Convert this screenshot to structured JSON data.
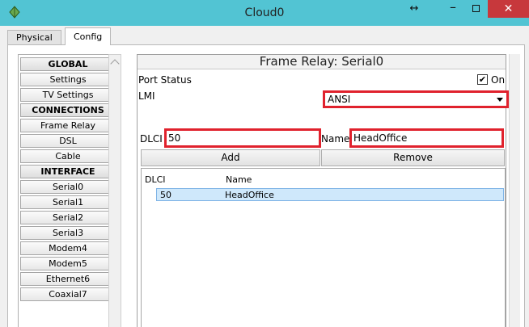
{
  "window": {
    "title": "Cloud0",
    "resize_glyph": "↔",
    "min_glyph": "–",
    "close_glyph": "✕",
    "app_icon": "cloud-device-icon"
  },
  "tabs": [
    {
      "label": "Physical",
      "active": false
    },
    {
      "label": "Config",
      "active": true
    }
  ],
  "sidebar": {
    "items": [
      {
        "label": "GLOBAL",
        "header": true
      },
      {
        "label": "Settings"
      },
      {
        "label": "TV Settings"
      },
      {
        "label": "CONNECTIONS",
        "header": true
      },
      {
        "label": "Frame Relay"
      },
      {
        "label": "DSL"
      },
      {
        "label": "Cable"
      },
      {
        "label": "INTERFACE",
        "header": true
      },
      {
        "label": "Serial0"
      },
      {
        "label": "Serial1"
      },
      {
        "label": "Serial2"
      },
      {
        "label": "Serial3"
      },
      {
        "label": "Modem4"
      },
      {
        "label": "Modem5"
      },
      {
        "label": "Ethernet6"
      },
      {
        "label": "Coaxial7"
      }
    ]
  },
  "main": {
    "title": "Frame Relay: Serial0",
    "port_status_label": "Port Status",
    "port_status_checked": true,
    "check_glyph": "✔",
    "on_label": "On",
    "lmi_label": "LMI",
    "lmi_value": "ANSI",
    "dlci_label": "DLCI",
    "dlci_value": "50",
    "name_label": "Name",
    "name_value": "HeadOffice",
    "add_label": "Add",
    "remove_label": "Remove",
    "table": {
      "columns": [
        "DLCI",
        "Name"
      ],
      "rows": [
        {
          "dlci": "50",
          "name": "HeadOffice"
        }
      ]
    }
  },
  "colors": {
    "titlebar": "#52c4d3",
    "highlight": "#e0222d",
    "selected_row": "#cfe8fb",
    "close": "#c7383c"
  }
}
